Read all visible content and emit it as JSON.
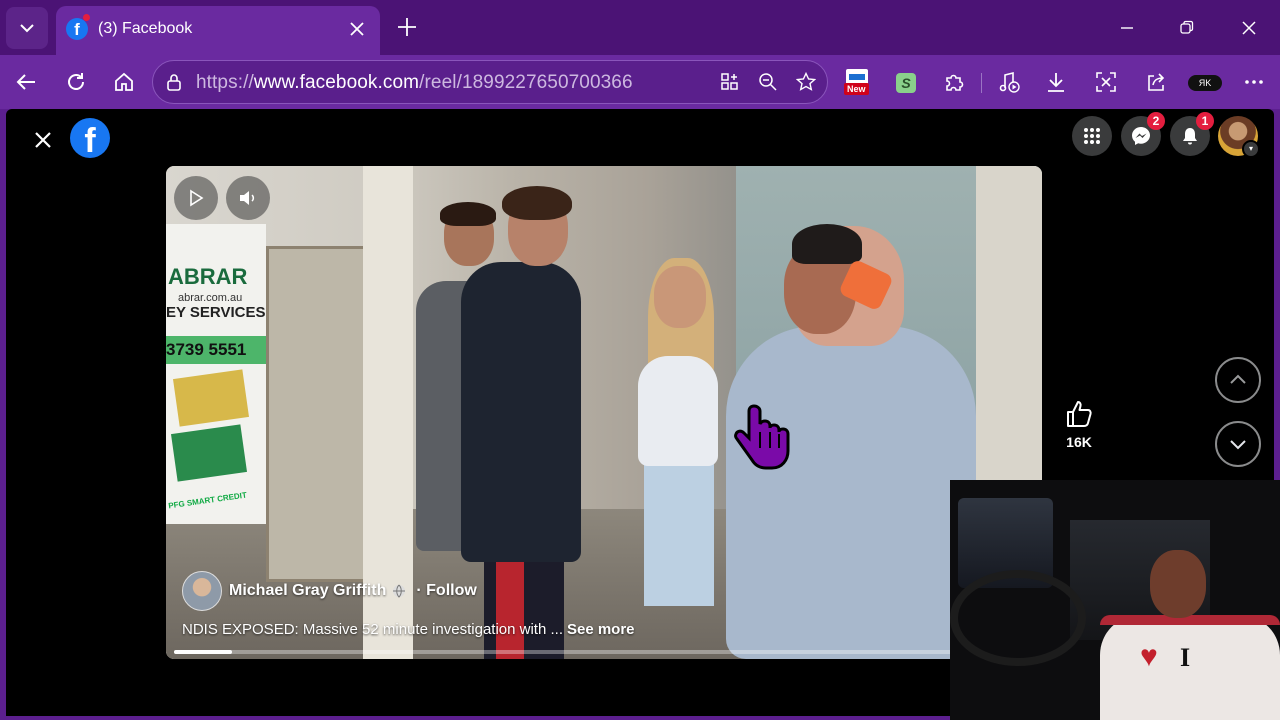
{
  "browser": {
    "tab": {
      "title": "(3) Facebook"
    },
    "url": {
      "prefix": "https://",
      "domain": "www.facebook.com",
      "path": "/reel/1899227650700366"
    },
    "extensions": {
      "new_badge": "New",
      "s_ext": "S",
      "profile_label": "ЯK"
    },
    "accent": "#6a2aa0"
  },
  "facebook": {
    "logo_letter": "f",
    "messenger_badge": "2",
    "notifications_badge": "1"
  },
  "video": {
    "author": "Michael Gray Griffith",
    "follow_label": "· Follow",
    "caption": "NDIS EXPOSED: Massive 52 minute investigation with ...",
    "see_more": "See more",
    "progress": 0.067,
    "sign": {
      "brand": "ABRAR",
      "site": "abrar.com.au",
      "services": "EY SERVICES",
      "phone": "3739 5551",
      "card": "PFG SMART CREDIT"
    }
  },
  "actions": {
    "like_count": "16K"
  },
  "webcam": {
    "shirt_letter": "I",
    "shirt_heart": "♥"
  }
}
